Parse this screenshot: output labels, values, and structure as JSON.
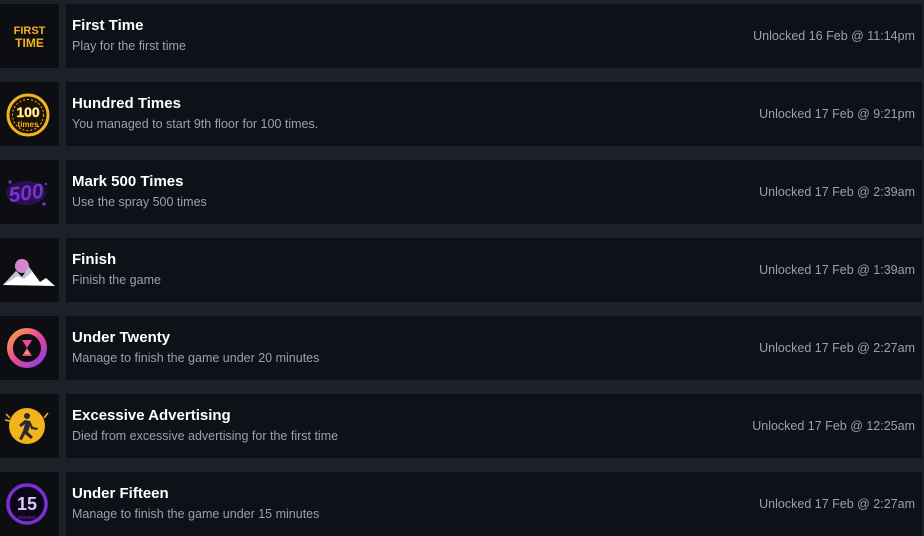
{
  "achievements": [
    {
      "title": "First Time",
      "description": "Play for the first time",
      "unlocked": "Unlocked 16 Feb @ 11:14pm",
      "icon": "first-time-icon",
      "icon_text_1": "FIRST",
      "icon_text_2": "TIME"
    },
    {
      "title": "Hundred Times",
      "description": "You managed to start 9th floor for 100 times.",
      "unlocked": "Unlocked 17 Feb @ 9:21pm",
      "icon": "hundred-times-icon",
      "icon_text_1": "100",
      "icon_text_2": "times"
    },
    {
      "title": "Mark 500 Times",
      "description": "Use the spray 500 times",
      "unlocked": "Unlocked 17 Feb @ 2:39am",
      "icon": "spray-500-icon",
      "icon_text_1": "500"
    },
    {
      "title": "Finish",
      "description": "Finish the game",
      "unlocked": "Unlocked 17 Feb @ 1:39am",
      "icon": "mountain-moon-icon"
    },
    {
      "title": "Under Twenty",
      "description": "Manage to finish the game under 20 minutes",
      "unlocked": "Unlocked 17 Feb @ 2:27am",
      "icon": "hourglass-ring-icon"
    },
    {
      "title": "Excessive Advertising",
      "description": "Died from excessive advertising for the first time",
      "unlocked": "Unlocked 17 Feb @ 12:25am",
      "icon": "running-man-icon"
    },
    {
      "title": "Under Fifteen",
      "description": "Manage to finish the game under 15 minutes",
      "unlocked": "Unlocked 17 Feb @ 2:27am",
      "icon": "fifteen-ring-icon",
      "icon_text_1": "15",
      "icon_text_2": "minutes"
    }
  ],
  "colors": {
    "page_bg": "#1b2029",
    "row_bg": "#0e1117",
    "icon_bg": "#0d0e12",
    "title": "#ffffff",
    "muted": "#9aa1ab",
    "gold": "#f2b31c",
    "purple": "#7b2fd8",
    "pink": "#e8489a"
  }
}
